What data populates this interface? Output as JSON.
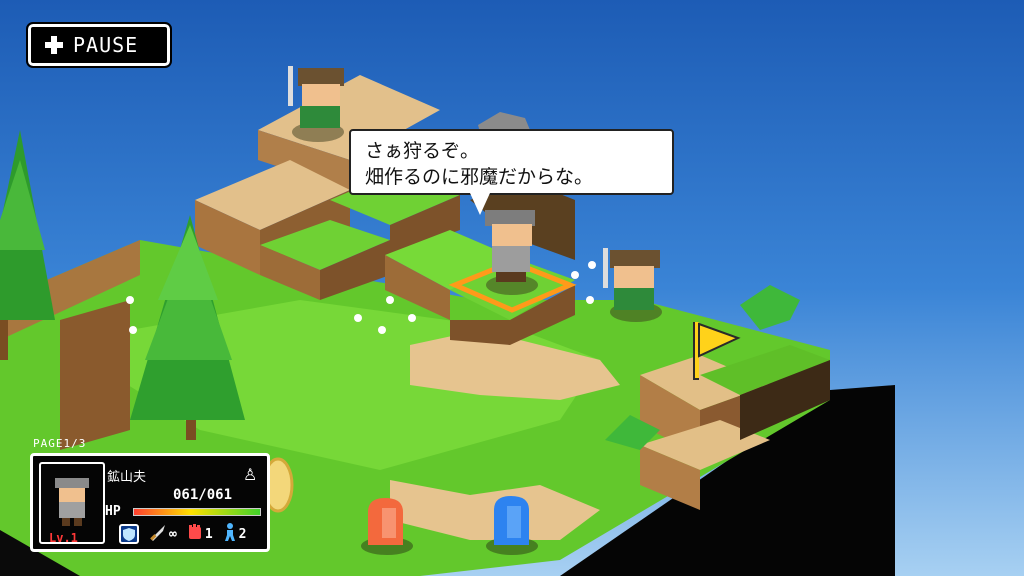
{
  "hud": {
    "pause_label": "PAUSE",
    "page_indicator": "PAGE1/3"
  },
  "dialogue": {
    "line1": "さぁ狩るぞ。",
    "line2": "畑作るのに邪魔だからな。"
  },
  "unit_status": {
    "name": "鉱山夫",
    "level": "Lv.1",
    "hp_label": "HP",
    "hp_text": "061/061",
    "hp_fraction": 1.0,
    "attack_range": "∞",
    "power": "1",
    "move": "2"
  },
  "colors": {
    "grass": "#6fcf2f",
    "dirt": "#e2c089",
    "cliff": "#a9794a",
    "flag": "#ffd21a",
    "ghost_red": "#f3693d",
    "ghost_blue": "#2d83f0",
    "select": "#ff9a1a"
  },
  "icons": [
    "plus-icon",
    "pawn-icon",
    "shield-icon",
    "sword-icon",
    "fist-icon",
    "walker-icon",
    "flag-icon"
  ]
}
